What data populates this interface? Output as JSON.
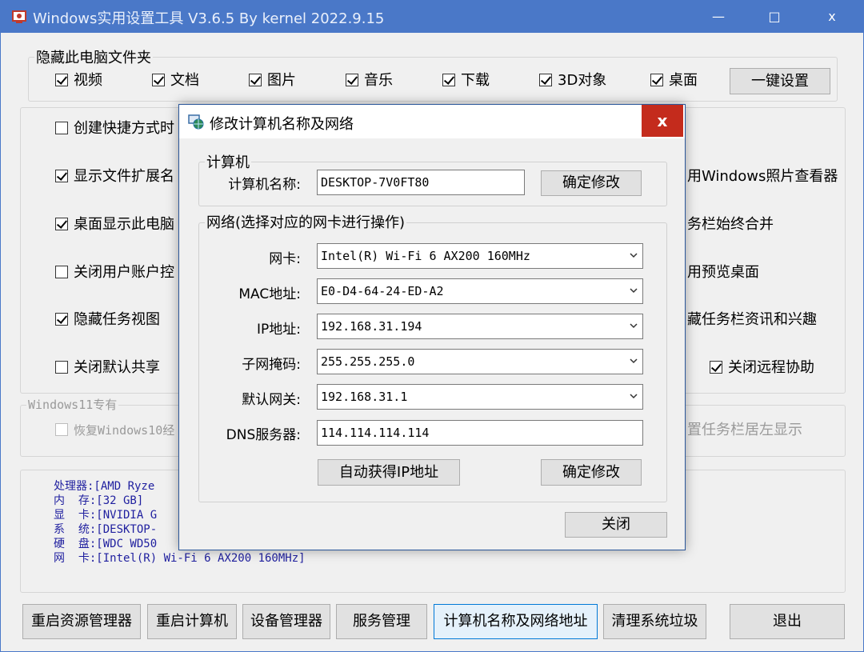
{
  "window": {
    "title": "Windows实用设置工具 V3.6.5 By kernel 2022.9.15",
    "minimize": "—",
    "maximize": "□",
    "close": "x"
  },
  "hide_folders": {
    "title": "隐藏此电脑文件夹",
    "items": [
      {
        "label": "视频",
        "checked": true
      },
      {
        "label": "文档",
        "checked": true
      },
      {
        "label": "图片",
        "checked": true
      },
      {
        "label": "音乐",
        "checked": true
      },
      {
        "label": "下载",
        "checked": true
      },
      {
        "label": "3D对象",
        "checked": true
      },
      {
        "label": "桌面",
        "checked": true
      }
    ],
    "apply_button": "一键设置"
  },
  "options_left": [
    {
      "label": "创建快捷方式时",
      "checked": false
    },
    {
      "label": "显示文件扩展名",
      "checked": true
    },
    {
      "label": "桌面显示此电脑",
      "checked": true
    },
    {
      "label": "关闭用户账户控",
      "checked": false
    },
    {
      "label": "隐藏任务视图",
      "checked": true
    },
    {
      "label": "关闭默认共享",
      "checked": false
    }
  ],
  "options_right": [
    {
      "label": "用Windows照片查看器"
    },
    {
      "label": "务栏始终合并"
    },
    {
      "label": "用预览桌面"
    },
    {
      "label": "藏任务栏资讯和兴趣"
    }
  ],
  "remote_assist": {
    "label": "关闭远程协助",
    "checked": true
  },
  "win11": {
    "title": "Windows11专有",
    "restore_label": "恢复Windows10经",
    "right_label": "置任务栏居左显示"
  },
  "sysinfo": {
    "lines": [
      "处理器:[AMD Ryze",
      "内  存:[32 GB]",
      "显  卡:[NVIDIA G",
      "系  统:[DESKTOP-",
      "硬  盘:[WDC WD50",
      "网  卡:[Intel(R) Wi-Fi 6 AX200 160MHz]"
    ]
  },
  "bottom_buttons": [
    "重启资源管理器",
    "重启计算机",
    "设备管理器",
    "服务管理",
    "计算机名称及网络地址",
    "清理系统垃圾",
    "退出"
  ],
  "dialog": {
    "title": "修改计算机名称及网络",
    "close": "x",
    "computer_group": "计算机",
    "computer_name_label": "计算机名称:",
    "computer_name_value": "DESKTOP-7V0FT80",
    "confirm_button": "确定修改",
    "network_group": "网络(选择对应的网卡进行操作)",
    "fields": [
      {
        "label": "网卡:",
        "value": "Intel(R) Wi-Fi 6 AX200 160MHz",
        "dropdown": true
      },
      {
        "label": "MAC地址:",
        "value": "E0-D4-64-24-ED-A2",
        "dropdown": true
      },
      {
        "label": "IP地址:",
        "value": "192.168.31.194",
        "dropdown": true
      },
      {
        "label": "子网掩码:",
        "value": "255.255.255.0",
        "dropdown": true
      },
      {
        "label": "默认网关:",
        "value": "192.168.31.1",
        "dropdown": true
      },
      {
        "label": "DNS服务器:",
        "value": "114.114.114.114",
        "dropdown": false
      }
    ],
    "auto_ip_button": "自动获得IP地址",
    "net_confirm_button": "确定修改",
    "close_button": "关闭"
  }
}
